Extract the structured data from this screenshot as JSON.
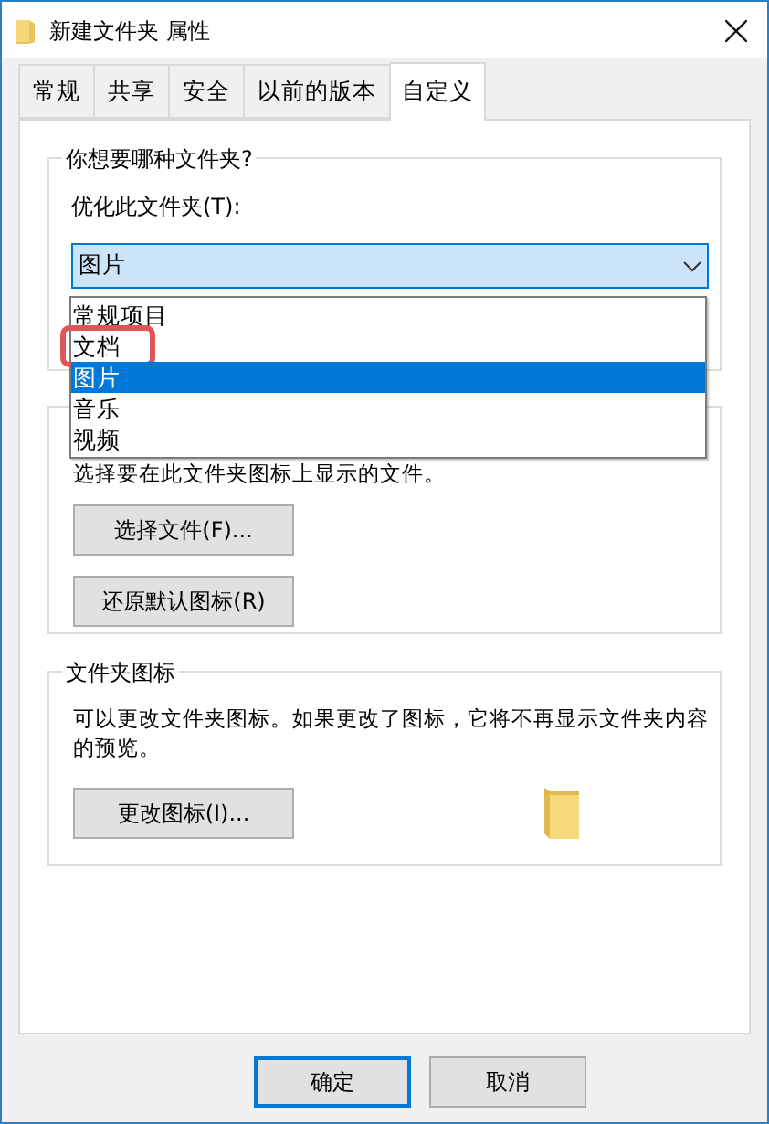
{
  "window": {
    "title": "新建文件夹 属性"
  },
  "tabs": [
    {
      "label": "常规",
      "selected": false
    },
    {
      "label": "共享",
      "selected": false
    },
    {
      "label": "安全",
      "selected": false
    },
    {
      "label": "以前的版本",
      "selected": false
    },
    {
      "label": "自定义",
      "selected": true
    }
  ],
  "folder_type": {
    "title": "你想要哪种文件夹?",
    "label": "优化此文件夹(T):",
    "value": "图片",
    "expanded": true,
    "options": [
      {
        "label": "常规项目",
        "selected": false,
        "annotated": false
      },
      {
        "label": "文档",
        "selected": false,
        "annotated": true
      },
      {
        "label": "图片",
        "selected": true,
        "annotated": false
      },
      {
        "label": "音乐",
        "selected": false,
        "annotated": false
      },
      {
        "label": "视频",
        "selected": false,
        "annotated": false
      }
    ]
  },
  "folder_pictures": {
    "description": "选择要在此文件夹图标上显示的文件。",
    "buttons": [
      "选择文件(F)...",
      "还原默认图标(R)"
    ]
  },
  "folder_icons": {
    "title": "文件夹图标",
    "description": "可以更改文件夹图标。如果更改了图标，它将不再显示文件夹内容的预览。",
    "button": "更改图标(I)..."
  },
  "buttons": [
    {
      "label": "确定",
      "default": true
    },
    {
      "label": "取消",
      "default": false
    }
  ]
}
